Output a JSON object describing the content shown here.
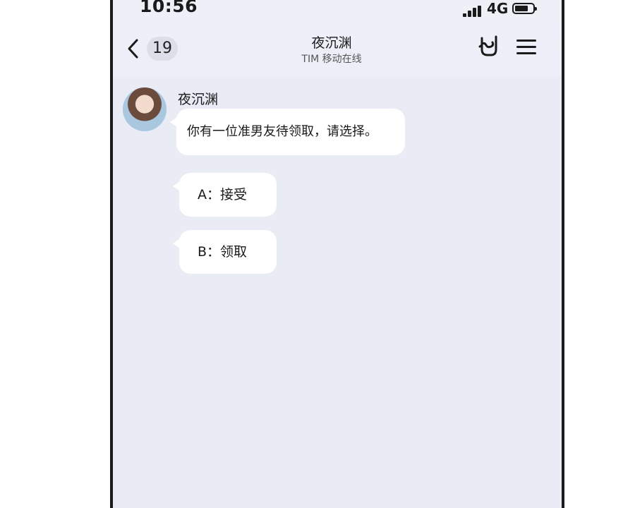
{
  "status_bar": {
    "time": "10:56",
    "network": "4G",
    "signal_bars": 4,
    "battery_level": 0.65
  },
  "header": {
    "unread_count": "19",
    "chat_name": "夜沉渊",
    "status": "TIM 移动在线"
  },
  "messages": [
    {
      "sender": "夜沉渊",
      "text": "你有一位准男友待领取，请选择。"
    }
  ],
  "options": [
    {
      "label": "A：接受"
    },
    {
      "label": "B：领取"
    }
  ],
  "colors": {
    "background": "#e9ecf5",
    "bubble": "#ffffff",
    "badge": "#dcdfe8",
    "text": "#1a1a1a"
  },
  "icons": [
    "back-chevron-icon",
    "rock-hand-icon",
    "menu-icon",
    "signal-icon",
    "battery-icon"
  ]
}
